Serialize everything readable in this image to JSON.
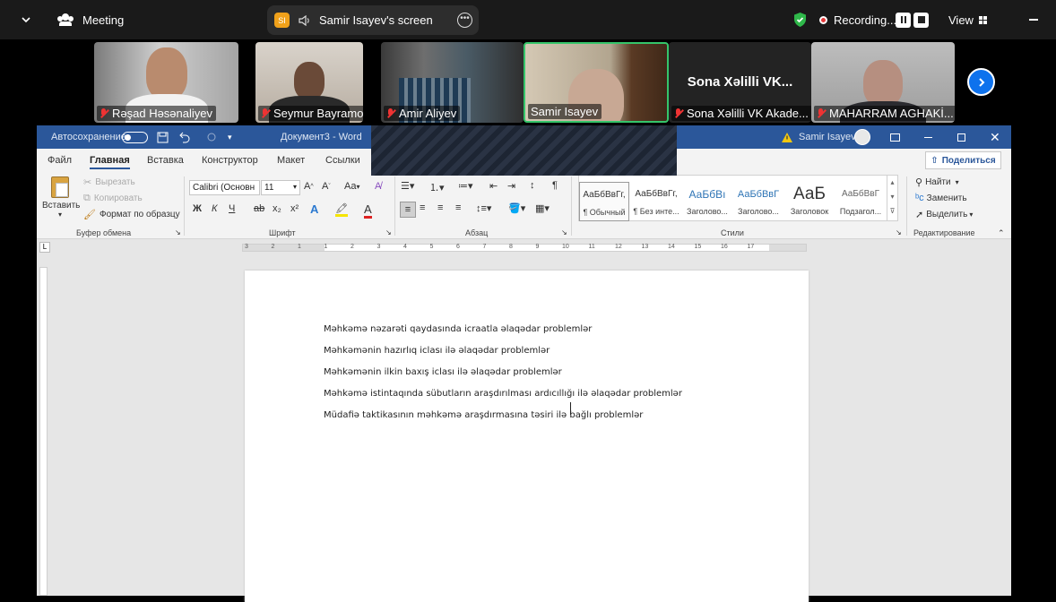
{
  "zoom": {
    "meeting_label": "Meeting",
    "share_badge": "SI",
    "share_title": "Samir Isayev's screen",
    "recording_label": "Recording...",
    "view_label": "View",
    "participants": [
      {
        "name": "Rəşad Həsənaliyev",
        "kind": "video"
      },
      {
        "name": "Seymur Bayramov",
        "kind": "video"
      },
      {
        "name": "Amir Aliyev",
        "kind": "video"
      },
      {
        "name": "Samir Isayev",
        "kind": "video",
        "active": true
      },
      {
        "name": "Sona Xəlilli VK Akade...",
        "kind": "text",
        "display": "Sona Xəlilli VK..."
      },
      {
        "name": "MAHARRAM AGHAKİ...",
        "kind": "video"
      }
    ],
    "colors": {
      "active_border": "#35c56a",
      "accent_blue": "#0e72ed",
      "shield": "#2fb84a",
      "record_dot": "#e5393a"
    }
  },
  "word": {
    "autosave_label": "Автосохранение",
    "doc_title": "Документ3 - Word",
    "user_name": "Samir Isayev",
    "tabs": [
      "Файл",
      "Главная",
      "Вставка",
      "Конструктор",
      "Макет",
      "Ссылки"
    ],
    "active_tab": "Главная",
    "share_button": "Поделиться",
    "clipboard": {
      "paste": "Вставить",
      "cut": "Вырезать",
      "copy": "Копировать",
      "format_painter": "Формат по образцу",
      "group": "Буфер обмена"
    },
    "font": {
      "name": "Calibri (Основн",
      "size": "11",
      "group": "Шрифт",
      "bold": "Ж",
      "italic": "К",
      "underline": "Ч",
      "strike": "ab",
      "sub": "x₂",
      "sup": "x²",
      "case": "Aa"
    },
    "paragraph": {
      "group": "Абзац"
    },
    "styles": {
      "group": "Стили",
      "cards": [
        {
          "preview": "АаБбВвГг,",
          "label": "¶ Обычный"
        },
        {
          "preview": "АаБбВвГг,",
          "label": "¶ Без инте..."
        },
        {
          "preview": "АаБбВı",
          "label": "Заголово..."
        },
        {
          "preview": "АаБбВвГ",
          "label": "Заголово..."
        },
        {
          "preview": "АаБ",
          "label": "Заголовок"
        },
        {
          "preview": "АаБбВвГ",
          "label": "Подзагол..."
        }
      ]
    },
    "editing": {
      "find": "Найти",
      "replace": "Заменить",
      "select": "Выделить",
      "group": "Редактирование"
    },
    "ruler_numbers": [
      "3",
      "2",
      "1",
      "1",
      "2",
      "3",
      "4",
      "5",
      "6",
      "7",
      "8",
      "9",
      "10",
      "11",
      "12",
      "13",
      "14",
      "15",
      "16",
      "17"
    ],
    "paragraphs": [
      "Məhkəmə nəzarəti qaydasında icraatla əlaqədar problemlər",
      "Məhkəmənin hazırlıq iclası ilə əlaqədar problemlər",
      "Məhkəmənin ilkin baxış iclası ilə əlaqədar problemlər",
      "Məhkəmə istintaqında sübutların araşdırılması ardıcıllığı ilə əlaqədar problemlər",
      "Müdafiə taktikasının məhkəmə araşdırmasına təsiri ilə bağlı problemlər"
    ]
  }
}
